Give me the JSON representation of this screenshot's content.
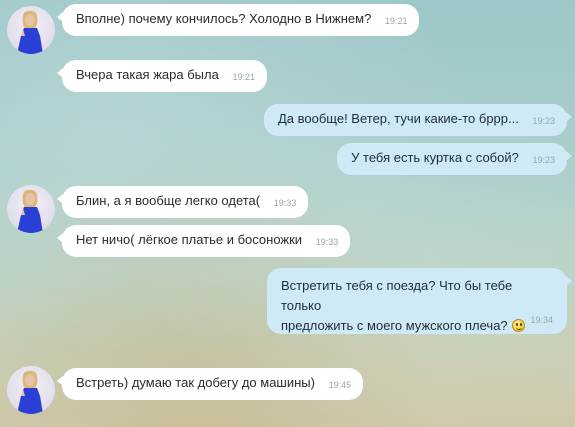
{
  "messages": [
    {
      "direction": "in",
      "text": "Вполне) почему кончилось? Холодно в Нижнем?",
      "time": "19:21"
    },
    {
      "direction": "in",
      "text": "Вчера такая жара была",
      "time": "19:21"
    },
    {
      "direction": "out",
      "text": "Да вообще! Ветер, тучи какие-то бррр...",
      "time": "19:23"
    },
    {
      "direction": "out",
      "text": "У тебя есть куртка с собой?",
      "time": "19:23"
    },
    {
      "direction": "in",
      "text": "Блин, а я вообще легко одета(",
      "time": "19:33"
    },
    {
      "direction": "in",
      "text": "Нет ничо( лёгкое платье и босоножки",
      "time": "19:33"
    },
    {
      "direction": "out",
      "text_line1": "Встретить тебя с поезда? Что бы тебе только",
      "text_line2": "предложить с моего мужского плеча?",
      "emoji": "smiley-emoji",
      "time": "19:34"
    },
    {
      "direction": "in",
      "text": "Встреть) думаю так добегу до машины)",
      "time": "19:45"
    }
  ],
  "avatar_icon": "contact-avatar",
  "colors": {
    "incoming_bubble": "#ffffff",
    "outgoing_bubble": "#cfe9f7",
    "time_text": "#9aa6ad"
  }
}
